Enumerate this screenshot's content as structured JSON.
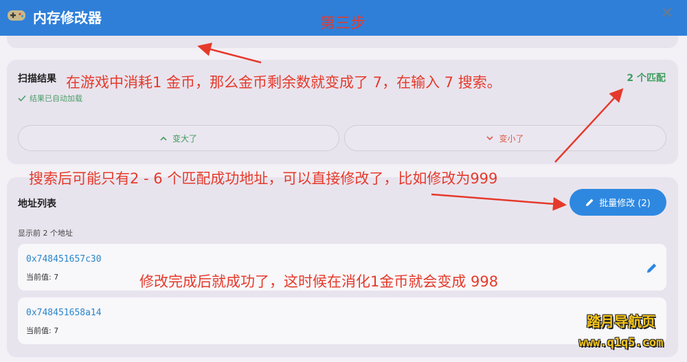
{
  "header": {
    "title": "内存修改器",
    "gamepad_icon": "gamepad-icon",
    "close_icon": "close-icon",
    "close_label": "✕"
  },
  "scan": {
    "title": "扫描结果",
    "auto_loaded": "结果已自动加载",
    "match_count": "2 个匹配",
    "bigger_label": "变大了",
    "smaller_label": "变小了"
  },
  "address_list": {
    "title": "地址列表",
    "batch_button": "批量修改 (2)",
    "showing": "显示前 2 个地址",
    "items": [
      {
        "address": "0x748451657c30",
        "current": "当前值: 7"
      },
      {
        "address": "0x748451658a14",
        "current": "当前值: 7"
      }
    ]
  },
  "annotations": {
    "step": "第三步",
    "note1": "在游戏中消耗1 金币，那么金币剩余数就变成了 7，在输入 7 搜索。",
    "note2": "搜索后可能只有2 - 6 个匹配成功地址，可以直接修改了，比如修改为999",
    "note3": "修改完成后就成功了，这时候在消化1金币就会变成 998"
  },
  "watermark": {
    "line1": "踏月导航页",
    "line2": "www.q1q5.com"
  },
  "colors": {
    "header": "#2f7fd8",
    "accent": "#2e88e0",
    "green": "#3d9e5c",
    "red": "#d95b4a",
    "annotation": "#e53a2b"
  }
}
